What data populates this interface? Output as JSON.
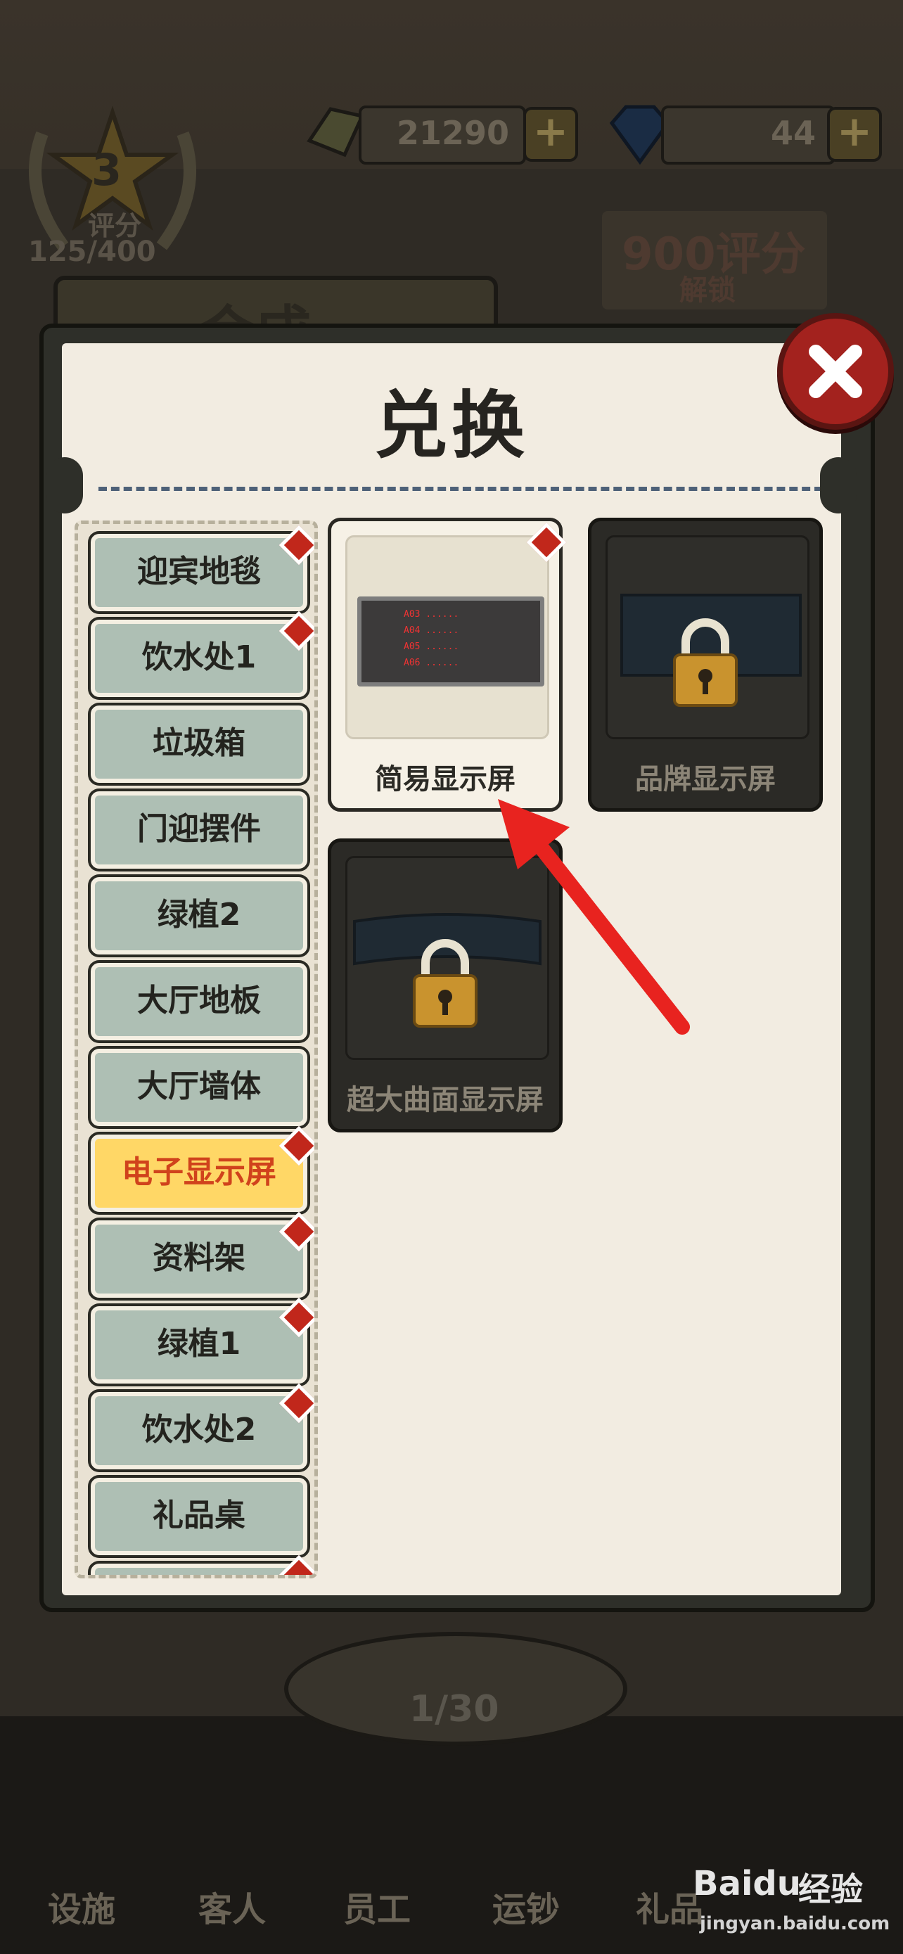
{
  "header": {
    "cash_value": "21290",
    "gem_value": "44",
    "rating_level": "3",
    "rating_label": "评分",
    "rating_progress": "125/400",
    "unlock_hint": "900评分",
    "unlock_hint_sub": "解锁"
  },
  "dialog": {
    "title": "兑换",
    "categories": [
      {
        "label": "迎宾地毯",
        "badge": true
      },
      {
        "label": "饮水处1",
        "badge": true
      },
      {
        "label": "垃圾箱",
        "badge": false
      },
      {
        "label": "门迎摆件",
        "badge": false
      },
      {
        "label": "绿植2",
        "badge": false
      },
      {
        "label": "大厅地板",
        "badge": false
      },
      {
        "label": "大厅墙体",
        "badge": false
      },
      {
        "label": "电子显示屏",
        "badge": true,
        "selected": true
      },
      {
        "label": "资料架",
        "badge": true
      },
      {
        "label": "绿植1",
        "badge": true
      },
      {
        "label": "饮水处2",
        "badge": true
      },
      {
        "label": "礼品桌",
        "badge": false
      }
    ],
    "items": [
      {
        "label": "简易显示屏",
        "locked": false,
        "badge": true,
        "screen_lines": [
          "A03 ......",
          "A04 ......",
          "A05 ......",
          "A06 ......"
        ]
      },
      {
        "label": "品牌显示屏",
        "locked": true
      },
      {
        "label": "超大曲面显示屏",
        "locked": true
      }
    ]
  },
  "background": {
    "behind_tab_title": "合成",
    "page_indicator": "1/30",
    "bottom_tabs": [
      "设施",
      "客人",
      "员工",
      "运钞",
      "礼品"
    ]
  },
  "watermark": {
    "brand": "Baidu",
    "brand_cn": "经验",
    "url": "jingyan.baidu.com"
  },
  "colors": {
    "accent_red": "#c1271b",
    "selected_bg": "#ffd766",
    "category_bg": "#aebfb4",
    "arrow": "#e8231f"
  }
}
